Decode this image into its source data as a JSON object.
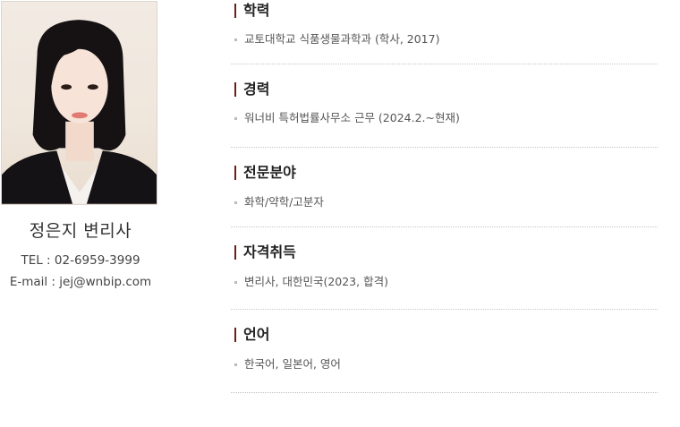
{
  "profile": {
    "name": "정은지 변리사",
    "phone": "TEL : 02-6959-3999",
    "email": "E-mail : jej@wnbip.com"
  },
  "sections": [
    {
      "title": "학력",
      "items": [
        "교토대학교 식품생물과학과 (학사, 2017)"
      ]
    },
    {
      "title": "경력",
      "items": [
        "워너비 특허법률사무소 근무 (2024.2.~현재)"
      ]
    },
    {
      "title": "전문분야",
      "items": [
        "화학/약학/고분자"
      ]
    },
    {
      "title": "자격취득",
      "items": [
        "변리사, 대한민국(2023, 합격)"
      ]
    },
    {
      "title": "언어",
      "items": [
        "한국어, 일본어, 영어"
      ]
    }
  ],
  "colors": {
    "accent": "#6b1f12",
    "divider": "#c6c6c6"
  }
}
